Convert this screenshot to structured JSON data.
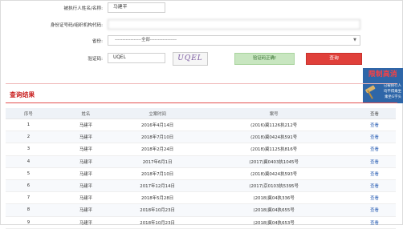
{
  "form": {
    "name_label": "被执行人姓名/名称:",
    "name_value": "马建平",
    "id_label": "身份证号码/组织机构代码:",
    "id_value": "",
    "province_label": "省份:",
    "province_value": "-----------------全部-----------------",
    "captcha_label": "验证码:",
    "captcha_value": "UQEL",
    "captcha_image_text": "UQEL",
    "verify_button": "验证码正确!",
    "search_button": "查询"
  },
  "ad": {
    "title": "限制高消",
    "lines": [
      "已被执行人",
      "均不得乘坐",
      "乘坐G字头"
    ]
  },
  "results": {
    "title": "查询结果",
    "columns": [
      "序号",
      "姓名",
      "立案时间",
      "案号",
      "查看"
    ],
    "rows": [
      [
        "1",
        "马建平",
        "2016年4月14日",
        "(2016)冀1126执212号",
        "查看"
      ],
      [
        "2",
        "马建平",
        "2018年7月10日",
        "(2018)冀0424执591号",
        "查看"
      ],
      [
        "3",
        "马建平",
        "2018年2月24日",
        "(2018)冀1125执816号",
        "查看"
      ],
      [
        "4",
        "马建平",
        "2017年6月1日",
        "(2017)冀0403执1045号",
        "查看"
      ],
      [
        "5",
        "马建平",
        "2018年7月10日",
        "(2018)冀0424执593号",
        "查看"
      ],
      [
        "6",
        "马建平",
        "2017年12月14日",
        "(2017)京0103执5395号",
        "查看"
      ],
      [
        "7",
        "马建平",
        "2018年5月28日",
        "(2018)冀04执336号",
        "查看"
      ],
      [
        "8",
        "马建平",
        "2018年10月23日",
        "(2018)冀04执655号",
        "查看"
      ],
      [
        "9",
        "马建平",
        "2018年10月23日",
        "(2018)冀04执653号",
        "查看"
      ]
    ]
  }
}
